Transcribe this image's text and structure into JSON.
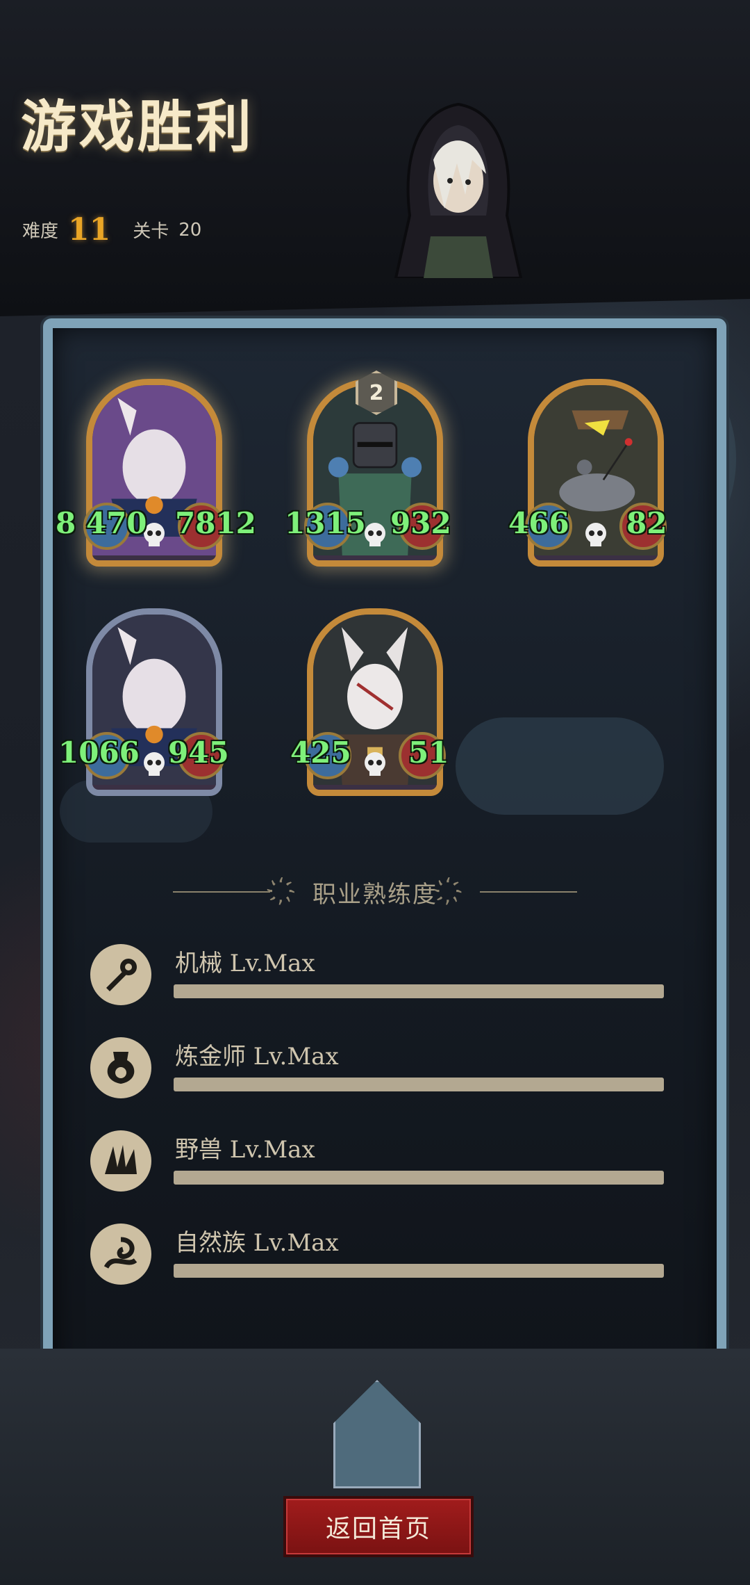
{
  "header": {
    "title": "游戏胜利",
    "difficulty_label": "难度",
    "difficulty_value": "11",
    "stage_label": "关卡",
    "stage_value": "20"
  },
  "units": [
    {
      "atk": "8 470",
      "hp": "7812",
      "frame": "gold",
      "glow": true
    },
    {
      "atk": "1315",
      "hp": "932",
      "frame": "gold",
      "glow": true,
      "badge": "2"
    },
    {
      "atk": "466",
      "hp": "82",
      "frame": "gold",
      "glow": false
    },
    {
      "atk": "1066",
      "hp": "945",
      "frame": "silver",
      "glow": false
    },
    {
      "atk": "425",
      "hp": "51",
      "frame": "gold",
      "glow": false
    }
  ],
  "proficiency": {
    "title": "职业熟练度",
    "items": [
      {
        "name": "机械 Lv.Max",
        "icon": "mechanic-icon",
        "progress": 1.0
      },
      {
        "name": "炼金师 Lv.Max",
        "icon": "alchemist-icon",
        "progress": 1.0
      },
      {
        "name": "野兽 Lv.Max",
        "icon": "beast-icon",
        "progress": 1.0
      },
      {
        "name": "自然族 Lv.Max",
        "icon": "nature-icon",
        "progress": 1.0
      }
    ]
  },
  "buttons": {
    "home": "返回首页"
  },
  "colors": {
    "accent_gold": "#e9a526",
    "stat_green": "#7ef07a",
    "button_red": "#a11c1c"
  }
}
